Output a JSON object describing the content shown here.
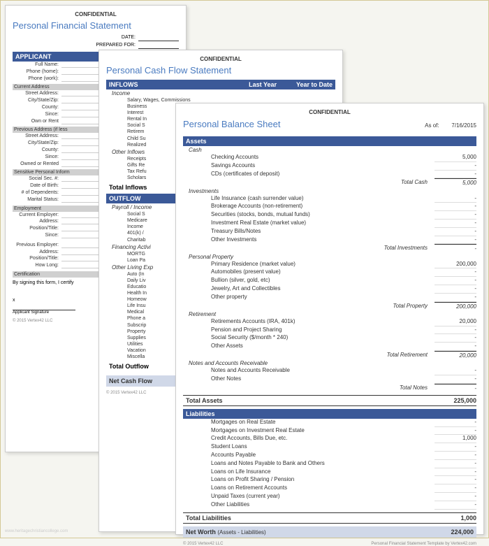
{
  "confidential": "CONFIDENTIAL",
  "footer_copyright": "© 2015 Vertex42 LLC",
  "footer_template": "Personal Financial Statement Template by Vertex42.com",
  "doc1": {
    "title": "Personal Financial Statement",
    "date_label": "DATE:",
    "prepared_label": "PREPARED FOR:",
    "applicant_header": "APPLICANT",
    "fields1": [
      "Full Name:",
      "Phone (home):",
      "Phone (work):"
    ],
    "current_addr_header": "Current Address",
    "addr_fields": [
      "Street Address:",
      "City/State/Zip:",
      "County:",
      "Since:",
      "Own or Rent"
    ],
    "prev_addr_header": "Previous Address (if less",
    "prev_addr_fields": [
      "Street Address:",
      "City/State/Zip:",
      "County:",
      "Since:",
      "Owned or Rented"
    ],
    "sensitive_header": "Sensitive Personal Inform",
    "sensitive_fields": [
      "Social Sec. #:",
      "Date of Birth:",
      "# of Dependents:",
      "Marital Status:"
    ],
    "employment_header": "Employment",
    "emp_fields": [
      "Current Employer:",
      "Address:",
      "Position/Title:",
      "Since:"
    ],
    "prev_emp_fields_header": "",
    "prev_emp_fields": [
      "Previous Employer:",
      "Address:",
      "Position/Title:",
      "How Long:"
    ],
    "cert_header": "Certification",
    "cert_text": "By signing this form, I certify",
    "sig_label": "Applicant Signature",
    "sig_x": "x"
  },
  "doc2": {
    "title": "Personal Cash Flow Statement",
    "inflows_header": "INFLOWS",
    "col_lastyear": "Last Year",
    "col_ytd": "Year to Date",
    "income_cat": "Income",
    "income_items": [
      "Salary, Wages, Commissions",
      "Business",
      "Interest",
      "Rental In",
      "Social S",
      "Retirem",
      "Child Su",
      "Realized"
    ],
    "other_inflows_cat": "Other Inflows",
    "other_inflow_items": [
      "Receipts",
      "Gifts Re",
      "Tax Refu",
      "Scholars"
    ],
    "total_inflows": "Total Inflows",
    "outflows_header": "OUTFLOW",
    "payroll_cat": "Payroll / Income",
    "payroll_items": [
      "Social S",
      "Medicare",
      "Income",
      "401(k) /",
      "Charitab"
    ],
    "financing_cat": "Financing Activi",
    "financing_items": [
      "MORTG",
      "Loan Pa"
    ],
    "living_cat": "Other Living Exp",
    "living_items": [
      "Auto (In",
      "Daily Liv",
      "Educatio",
      "Health In",
      "Homeow",
      "Life Insu",
      "Medical",
      "Phone a",
      "Subscrip",
      "Property",
      "Supplies",
      "Utilities",
      "Vacation",
      "Miscella"
    ],
    "total_outflows": "Total Outflow",
    "net_cashflow": "Net Cash Flow"
  },
  "doc3": {
    "title": "Personal Balance Sheet",
    "asof_label": "As of:",
    "asof_value": "7/16/2015",
    "assets_header": "Assets",
    "cash_cat": "Cash",
    "cash_items": [
      {
        "label": "Checking Accounts",
        "val": "5,000"
      },
      {
        "label": "Savings Accounts",
        "val": "-"
      },
      {
        "label": "CDs (certificates of deposit)",
        "val": "-"
      }
    ],
    "cash_subtotal_label": "Total Cash",
    "cash_subtotal": "5,000",
    "inv_cat": "Investments",
    "inv_items": [
      {
        "label": "Life Insurance (cash surrender value)",
        "val": "-"
      },
      {
        "label": "Brokerage Accounts (non-retirement)",
        "val": "-"
      },
      {
        "label": "Securities (stocks, bonds, mutual funds)",
        "val": "-"
      },
      {
        "label": "Investment Real Estate (market value)",
        "val": "-"
      },
      {
        "label": "Treasury Bills/Notes",
        "val": "-"
      },
      {
        "label": "Other Investments",
        "val": "-"
      }
    ],
    "inv_subtotal_label": "Total Investments",
    "inv_subtotal": "-",
    "prop_cat": "Personal Property",
    "prop_items": [
      {
        "label": "Primary Residence (market value)",
        "val": "200,000"
      },
      {
        "label": "Automobiles (present value)",
        "val": "-"
      },
      {
        "label": "Bullion (silver, gold, etc)",
        "val": "-"
      },
      {
        "label": "Jewelry, Art and Collectibles",
        "val": "-"
      },
      {
        "label": "Other property",
        "val": "-"
      }
    ],
    "prop_subtotal_label": "Total Property",
    "prop_subtotal": "200,000",
    "ret_cat": "Retirement",
    "ret_items": [
      {
        "label": "Retirements Accounts (IRA, 401k)",
        "val": "20,000"
      },
      {
        "label": "Pension and Project Sharing",
        "val": "-"
      },
      {
        "label": "Social Security ($/month * 240)",
        "val": "-"
      },
      {
        "label": "Other Assets",
        "val": "-"
      }
    ],
    "ret_subtotal_label": "Total Retirement",
    "ret_subtotal": "20,000",
    "notes_cat": "Notes and Accounts Receivable",
    "notes_items": [
      {
        "label": "Notes and Accounts Receivable",
        "val": "-"
      },
      {
        "label": "Other Notes",
        "val": "-"
      }
    ],
    "notes_subtotal_label": "Total Notes",
    "notes_subtotal": "-",
    "total_assets_label": "Total Assets",
    "total_assets": "225,000",
    "liab_header": "Liabilities",
    "liab_items": [
      {
        "label": "Mortgages on Real Estate",
        "val": "-"
      },
      {
        "label": "Mortgages on Investment Real Estate",
        "val": "-"
      },
      {
        "label": "Credit Accounts, Bills Due, etc.",
        "val": "1,000"
      },
      {
        "label": "Student Loans",
        "val": "-"
      },
      {
        "label": "Accounts Payable",
        "val": "-"
      },
      {
        "label": "Loans and Notes Payable to Bank and Others",
        "val": "-"
      },
      {
        "label": "Loans on Life Insurance",
        "val": "-"
      },
      {
        "label": "Loans on Profit Sharing / Pension",
        "val": "-"
      },
      {
        "label": "Loans on Retirement Accounts",
        "val": "-"
      },
      {
        "label": "Unpaid Taxes (current year)",
        "val": "-"
      },
      {
        "label": "Other Liabilities",
        "val": "-"
      }
    ],
    "total_liab_label": "Total Liabilities",
    "total_liab": "1,000",
    "networth_label": "Net Worth",
    "networth_sublabel": "(Assets - Liabilities)",
    "networth": "224,000"
  }
}
